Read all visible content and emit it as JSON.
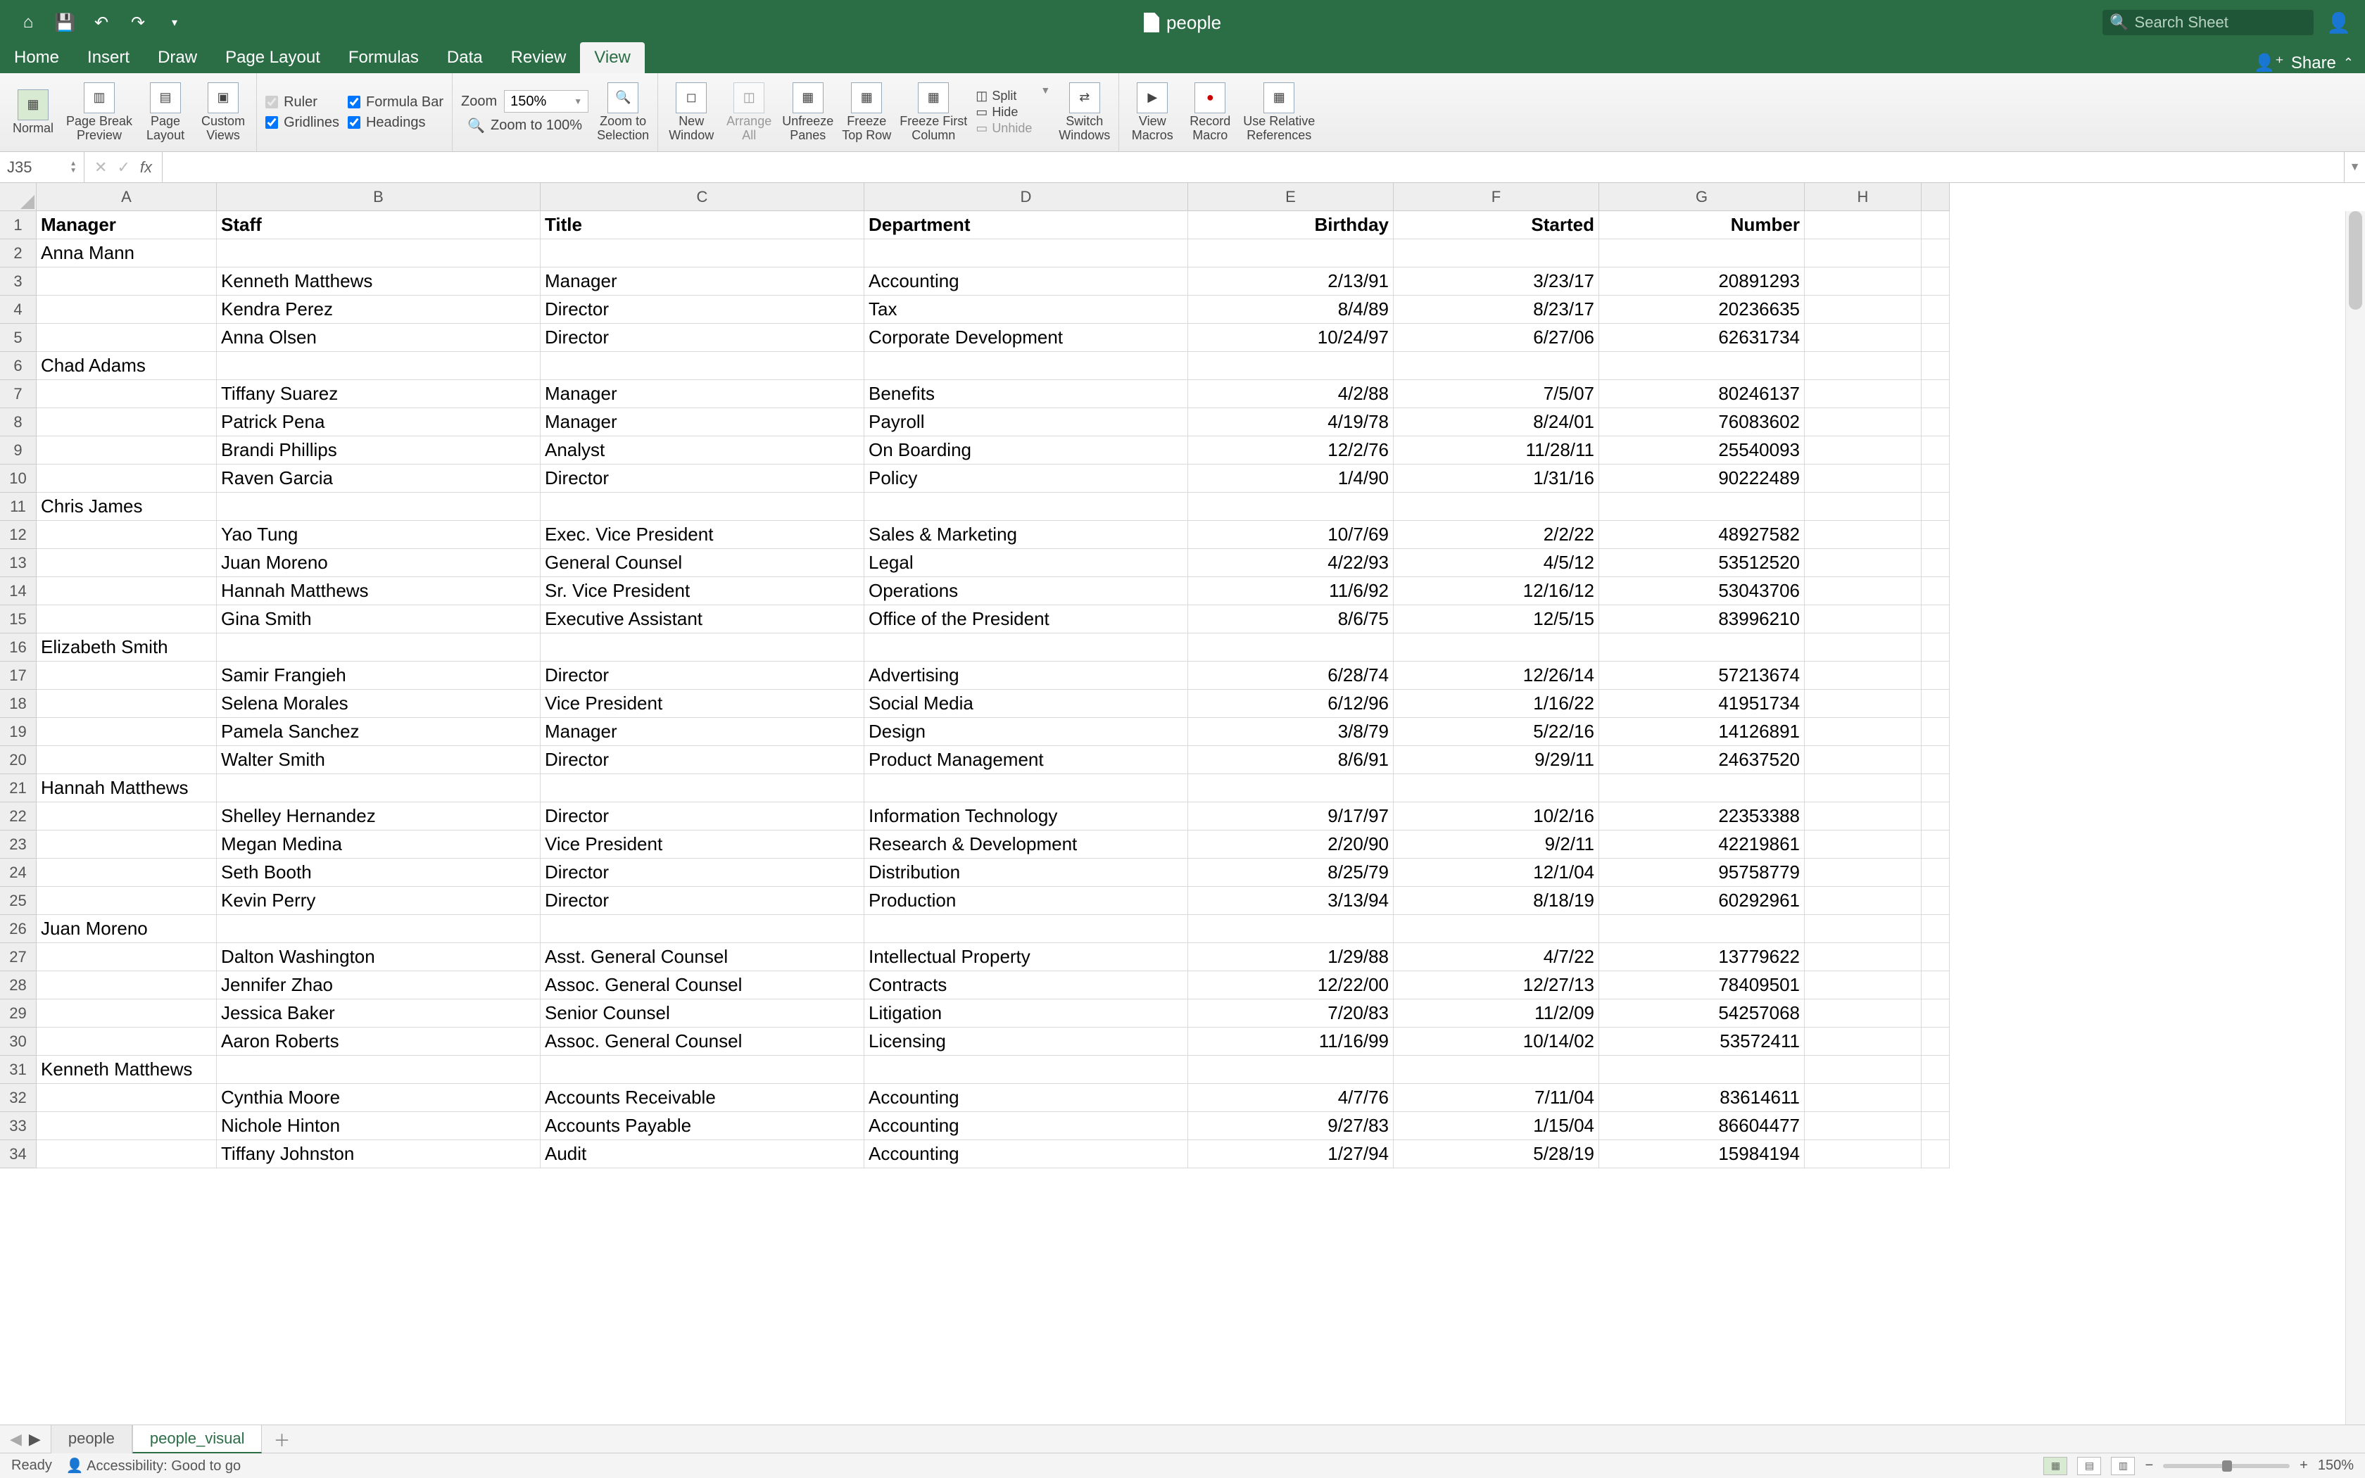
{
  "title": "people",
  "search_placeholder": "Search Sheet",
  "tabs": [
    "Home",
    "Insert",
    "Draw",
    "Page Layout",
    "Formulas",
    "Data",
    "Review",
    "View"
  ],
  "active_tab": "View",
  "share_label": "Share",
  "ribbon": {
    "views": {
      "normal": "Normal",
      "pbp": "Page Break\nPreview",
      "pl": "Page\nLayout",
      "cv": "Custom\nViews"
    },
    "show": {
      "ruler": "Ruler",
      "formula_bar": "Formula Bar",
      "gridlines": "Gridlines",
      "headings": "Headings"
    },
    "zoom": {
      "label": "Zoom",
      "value": "150%",
      "sel_label": "Zoom to\nSelection",
      "to100": "Zoom to 100%"
    },
    "window": {
      "new": "New\nWindow",
      "arrange": "Arrange\nAll",
      "unfreeze": "Unfreeze\nPanes",
      "ftop": "Freeze\nTop Row",
      "fcol": "Freeze First\nColumn",
      "split": "Split",
      "hide": "Hide",
      "unhide": "Unhide",
      "switch": "Switch\nWindows"
    },
    "macros": {
      "view": "View\nMacros",
      "record": "Record\nMacro",
      "rel": "Use Relative\nReferences"
    }
  },
  "namebox": "J35",
  "formula": "",
  "columns": [
    "A",
    "B",
    "C",
    "D",
    "E",
    "F",
    "G",
    "H"
  ],
  "headers": [
    "Manager",
    "Staff",
    "Title",
    "Department",
    "Birthday",
    "Started",
    "Number"
  ],
  "rows": [
    {
      "n": 2,
      "a": "Anna Mann"
    },
    {
      "n": 3,
      "b": "Kenneth Matthews",
      "c": "Manager",
      "d": "Accounting",
      "e": "2/13/91",
      "f": "3/23/17",
      "g": "20891293"
    },
    {
      "n": 4,
      "b": "Kendra Perez",
      "c": "Director",
      "d": "Tax",
      "e": "8/4/89",
      "f": "8/23/17",
      "g": "20236635"
    },
    {
      "n": 5,
      "b": "Anna Olsen",
      "c": "Director",
      "d": "Corporate Development",
      "e": "10/24/97",
      "f": "6/27/06",
      "g": "62631734"
    },
    {
      "n": 6,
      "a": "Chad Adams"
    },
    {
      "n": 7,
      "b": "Tiffany Suarez",
      "c": "Manager",
      "d": "Benefits",
      "e": "4/2/88",
      "f": "7/5/07",
      "g": "80246137"
    },
    {
      "n": 8,
      "b": "Patrick Pena",
      "c": "Manager",
      "d": "Payroll",
      "e": "4/19/78",
      "f": "8/24/01",
      "g": "76083602"
    },
    {
      "n": 9,
      "b": "Brandi Phillips",
      "c": "Analyst",
      "d": "On Boarding",
      "e": "12/2/76",
      "f": "11/28/11",
      "g": "25540093"
    },
    {
      "n": 10,
      "b": "Raven Garcia",
      "c": "Director",
      "d": "Policy",
      "e": "1/4/90",
      "f": "1/31/16",
      "g": "90222489"
    },
    {
      "n": 11,
      "a": "Chris James"
    },
    {
      "n": 12,
      "b": "Yao Tung",
      "c": "Exec. Vice President",
      "d": "Sales & Marketing",
      "e": "10/7/69",
      "f": "2/2/22",
      "g": "48927582"
    },
    {
      "n": 13,
      "b": "Juan Moreno",
      "c": "General Counsel",
      "d": "Legal",
      "e": "4/22/93",
      "f": "4/5/12",
      "g": "53512520"
    },
    {
      "n": 14,
      "b": "Hannah Matthews",
      "c": "Sr. Vice President",
      "d": "Operations",
      "e": "11/6/92",
      "f": "12/16/12",
      "g": "53043706"
    },
    {
      "n": 15,
      "b": "Gina Smith",
      "c": "Executive Assistant",
      "d": "Office of the President",
      "e": "8/6/75",
      "f": "12/5/15",
      "g": "83996210"
    },
    {
      "n": 16,
      "a": "Elizabeth Smith"
    },
    {
      "n": 17,
      "b": "Samir Frangieh",
      "c": "Director",
      "d": "Advertising",
      "e": "6/28/74",
      "f": "12/26/14",
      "g": "57213674"
    },
    {
      "n": 18,
      "b": "Selena Morales",
      "c": "Vice President",
      "d": "Social Media",
      "e": "6/12/96",
      "f": "1/16/22",
      "g": "41951734"
    },
    {
      "n": 19,
      "b": "Pamela Sanchez",
      "c": "Manager",
      "d": "Design",
      "e": "3/8/79",
      "f": "5/22/16",
      "g": "14126891"
    },
    {
      "n": 20,
      "b": "Walter Smith",
      "c": "Director",
      "d": "Product Management",
      "e": "8/6/91",
      "f": "9/29/11",
      "g": "24637520"
    },
    {
      "n": 21,
      "a": "Hannah Matthews"
    },
    {
      "n": 22,
      "b": "Shelley Hernandez",
      "c": "Director",
      "d": "Information Technology",
      "e": "9/17/97",
      "f": "10/2/16",
      "g": "22353388"
    },
    {
      "n": 23,
      "b": "Megan Medina",
      "c": "Vice President",
      "d": "Research & Development",
      "e": "2/20/90",
      "f": "9/2/11",
      "g": "42219861"
    },
    {
      "n": 24,
      "b": "Seth Booth",
      "c": "Director",
      "d": "Distribution",
      "e": "8/25/79",
      "f": "12/1/04",
      "g": "95758779"
    },
    {
      "n": 25,
      "b": "Kevin Perry",
      "c": "Director",
      "d": "Production",
      "e": "3/13/94",
      "f": "8/18/19",
      "g": "60292961"
    },
    {
      "n": 26,
      "a": "Juan Moreno"
    },
    {
      "n": 27,
      "b": "Dalton Washington",
      "c": "Asst. General Counsel",
      "d": "Intellectual Property",
      "e": "1/29/88",
      "f": "4/7/22",
      "g": "13779622"
    },
    {
      "n": 28,
      "b": "Jennifer Zhao",
      "c": "Assoc. General Counsel",
      "d": "Contracts",
      "e": "12/22/00",
      "f": "12/27/13",
      "g": "78409501"
    },
    {
      "n": 29,
      "b": "Jessica Baker",
      "c": "Senior Counsel",
      "d": "Litigation",
      "e": "7/20/83",
      "f": "11/2/09",
      "g": "54257068"
    },
    {
      "n": 30,
      "b": "Aaron Roberts",
      "c": "Assoc. General Counsel",
      "d": "Licensing",
      "e": "11/16/99",
      "f": "10/14/02",
      "g": "53572411"
    },
    {
      "n": 31,
      "a": "Kenneth Matthews"
    },
    {
      "n": 32,
      "b": "Cynthia Moore",
      "c": "Accounts Receivable",
      "d": "Accounting",
      "e": "4/7/76",
      "f": "7/11/04",
      "g": "83614611"
    },
    {
      "n": 33,
      "b": "Nichole Hinton",
      "c": "Accounts Payable",
      "d": "Accounting",
      "e": "9/27/83",
      "f": "1/15/04",
      "g": "86604477"
    },
    {
      "n": 34,
      "b": "Tiffany Johnston",
      "c": "Audit",
      "d": "Accounting",
      "e": "1/27/94",
      "f": "5/28/19",
      "g": "15984194"
    }
  ],
  "sheets": [
    "people",
    "people_visual"
  ],
  "active_sheet": "people_visual",
  "status": {
    "ready": "Ready",
    "a11y": "Accessibility: Good to go",
    "zoom": "150%"
  }
}
